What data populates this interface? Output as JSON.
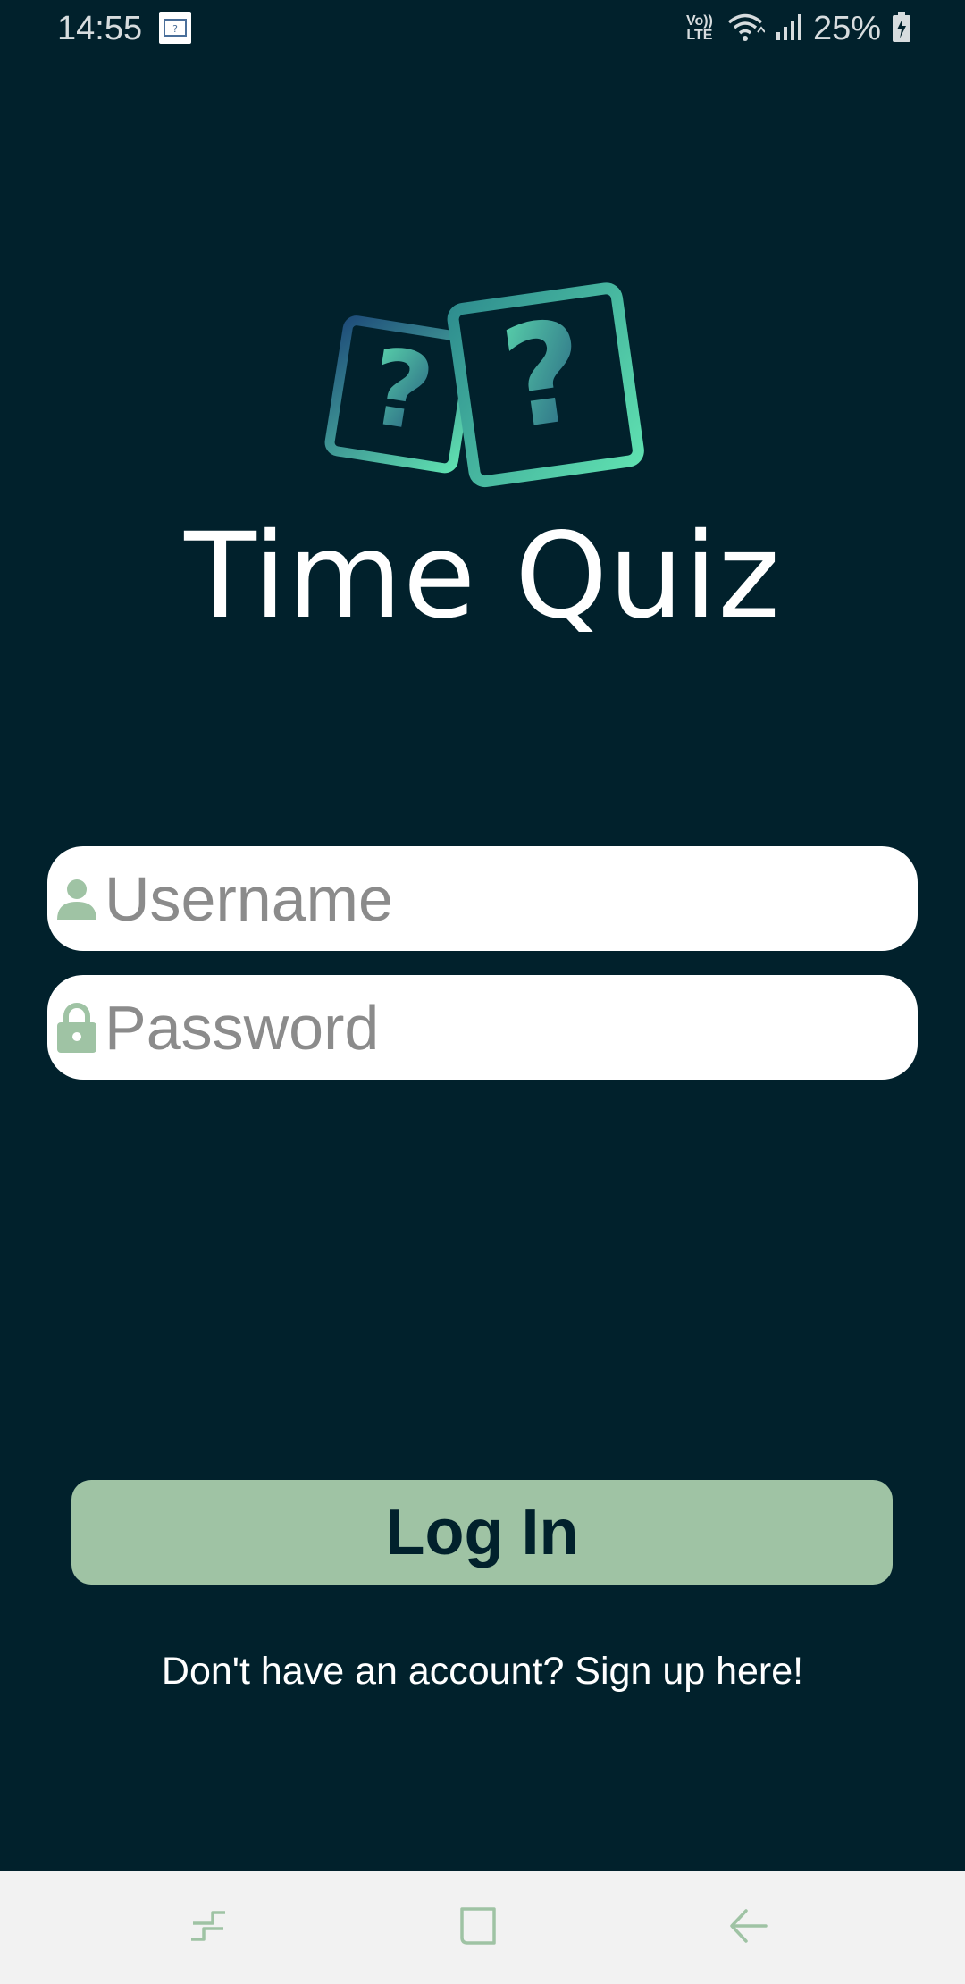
{
  "status_bar": {
    "time": "14:55",
    "network_label_top": "Vo))",
    "network_label_bottom": "LTE",
    "battery_percent": "25%"
  },
  "app": {
    "title": "Time Quiz",
    "logo_icon": "question-cards-logo",
    "colors": {
      "background": "#01212c",
      "accent": "#9fc3a4",
      "logo_gradient_start": "#1f4e7a",
      "logo_gradient_end": "#5fe0b0"
    }
  },
  "login_form": {
    "username_placeholder": "Username",
    "username_value": "",
    "username_icon": "user-icon",
    "password_placeholder": "Password",
    "password_value": "",
    "password_icon": "lock-icon",
    "login_label": "Log In",
    "signup_text": "Don't have an account? Sign up here!"
  },
  "nav_bar": {
    "recents_icon": "recents-icon",
    "home_icon": "home-icon",
    "back_icon": "back-icon"
  }
}
